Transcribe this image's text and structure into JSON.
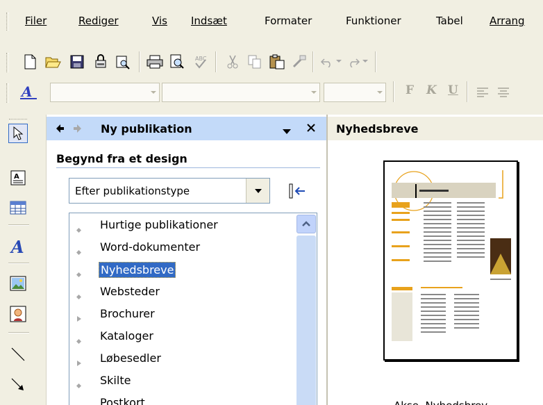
{
  "menubar": {
    "items": [
      {
        "label": "Filer"
      },
      {
        "label": "Rediger"
      },
      {
        "label": "Vis"
      },
      {
        "label": "Indsæt"
      },
      {
        "label": "Formater"
      },
      {
        "label": "Funktioner"
      },
      {
        "label": "Tabel"
      },
      {
        "label": "Arrang"
      }
    ]
  },
  "toolbar": {
    "icons": [
      "new-icon",
      "open-icon",
      "save-icon",
      "permission-icon",
      "search-icon",
      "print-icon",
      "print-preview-icon",
      "spelling-icon",
      "cut-icon",
      "copy-icon",
      "paste-icon",
      "format-painter-icon",
      "undo-icon",
      "redo-icon"
    ]
  },
  "format_toolbar": {
    "bold": "F",
    "italic": "K",
    "underline": "U"
  },
  "taskpane": {
    "title": "Ny publikation",
    "section_title": "Begynd fra et design",
    "dropdown_value": "Efter publikationstype",
    "items": [
      {
        "label": "Hurtige publikationer",
        "bullet": "dot"
      },
      {
        "label": "Word-dokumenter",
        "bullet": "dot"
      },
      {
        "label": "Nyhedsbreve",
        "bullet": "dot",
        "selected": true
      },
      {
        "label": "Websteder",
        "bullet": "dot"
      },
      {
        "label": "Brochurer",
        "bullet": "arrow"
      },
      {
        "label": "Kataloger",
        "bullet": "dot"
      },
      {
        "label": "Løbesedler",
        "bullet": "arrow"
      },
      {
        "label": "Skilte",
        "bullet": "dot"
      },
      {
        "label": "Postkort",
        "bullet": "arrow"
      }
    ]
  },
  "preview": {
    "title": "Nyhedsbreve",
    "caption": "Akse, Nyhedsbrev"
  },
  "colors": {
    "selection": "#316ac5",
    "pane_header": "#c3daf9",
    "chrome": "#f1efe2",
    "accent_gold": "#e8a21c"
  }
}
